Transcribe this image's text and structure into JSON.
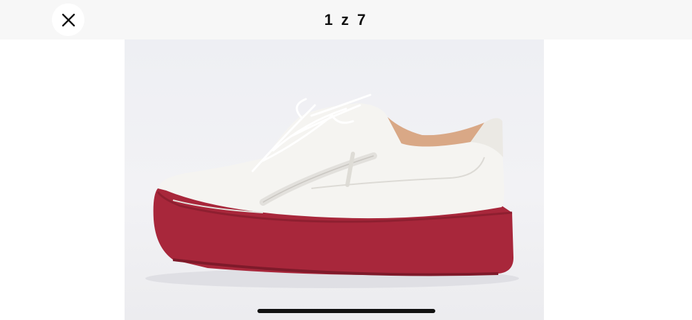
{
  "header": {
    "counter": "1 z 7"
  },
  "icons": {
    "close": "close-icon",
    "image": "sneaker-photo"
  },
  "colors": {
    "topbar_background": "#f7f7f7",
    "sole_red": "#a8273b",
    "upper_white": "#f5f4f1",
    "lining_tan": "#d9a886"
  }
}
